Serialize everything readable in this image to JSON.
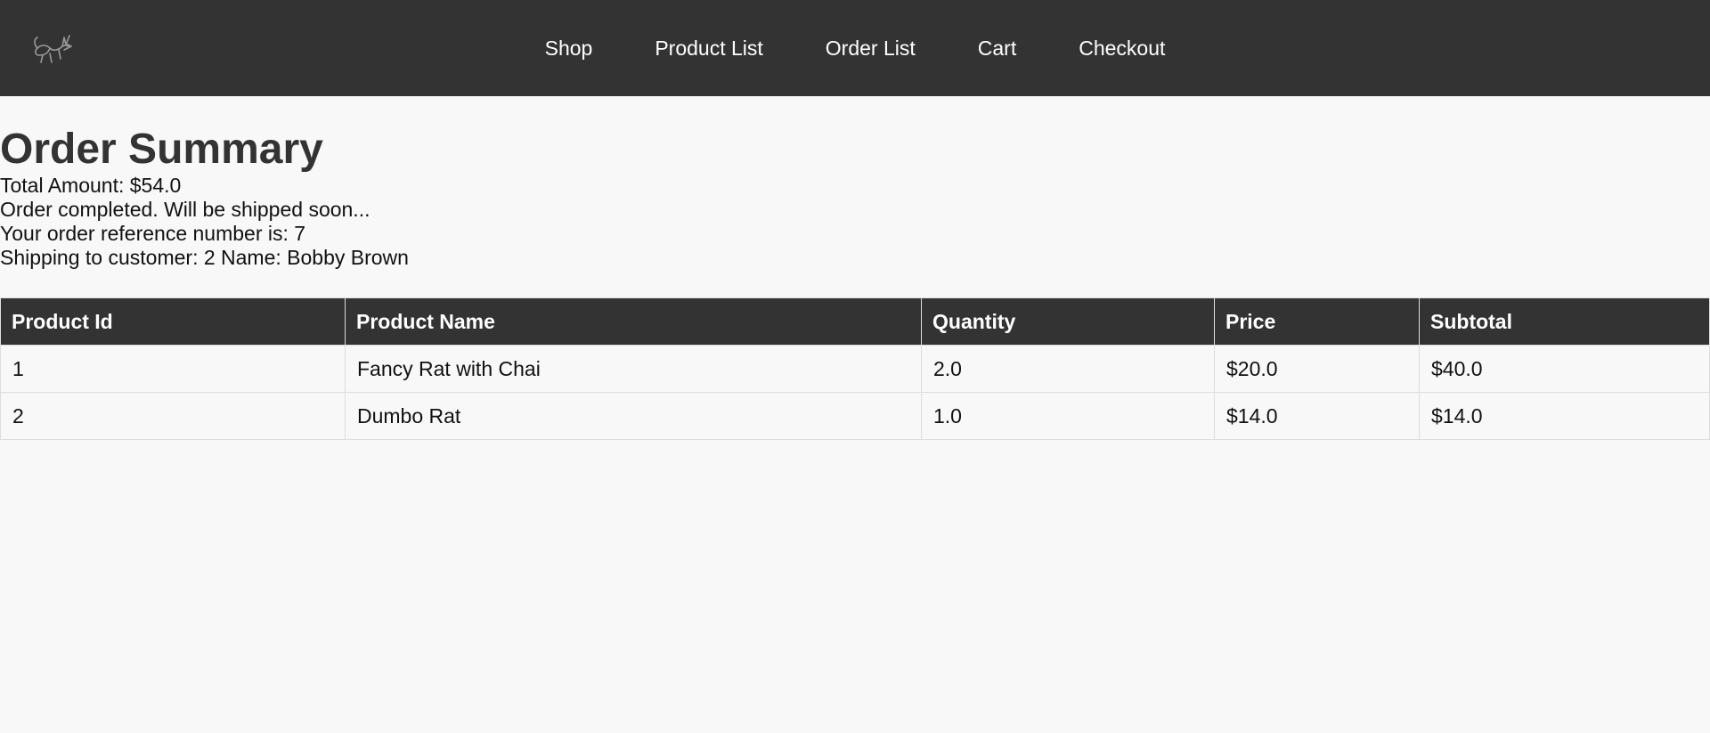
{
  "nav": {
    "links": [
      "Shop",
      "Product List",
      "Order List",
      "Cart",
      "Checkout"
    ]
  },
  "page": {
    "title": "Order Summary",
    "total_amount": "Total Amount: $54.0",
    "status": "Order completed. Will be shipped soon...",
    "reference": "Your order reference number is: 7",
    "shipping": "Shipping to customer: 2 Name: Bobby Brown"
  },
  "table": {
    "headers": [
      "Product Id",
      "Product Name",
      "Quantity",
      "Price",
      "Subtotal"
    ],
    "rows": [
      [
        "1",
        "Fancy Rat with Chai",
        "2.0",
        "$20.0",
        "$40.0"
      ],
      [
        "2",
        "Dumbo Rat",
        "1.0",
        "$14.0",
        "$14.0"
      ]
    ]
  },
  "colors": {
    "navbar": "#333333",
    "background": "#f8f8f8",
    "header": "#333333"
  },
  "icons": {
    "logo": "rat-logo-icon"
  }
}
